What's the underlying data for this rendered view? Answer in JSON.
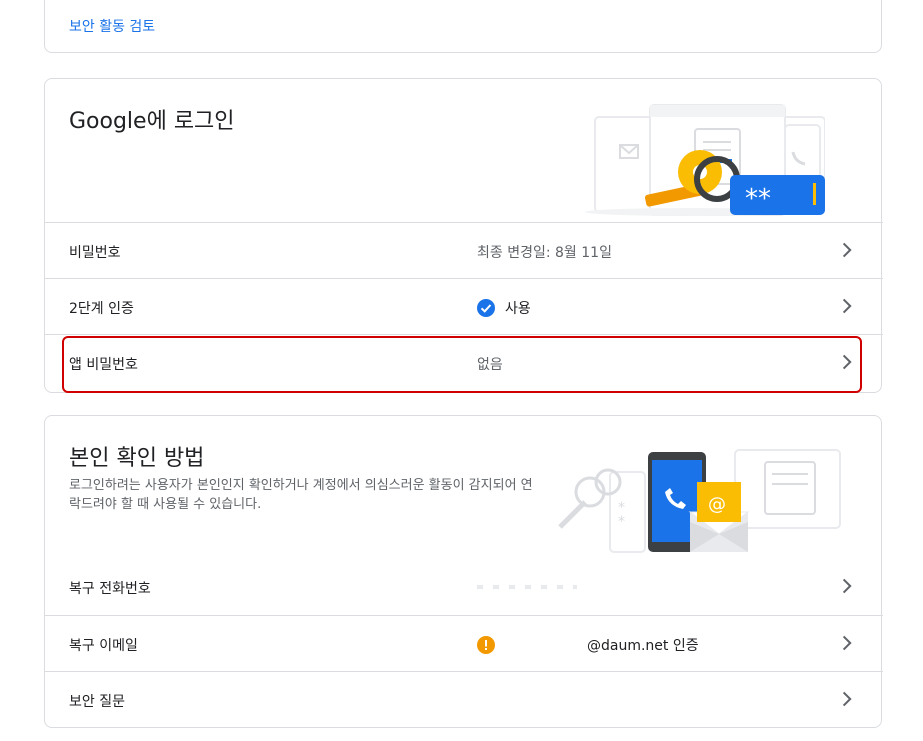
{
  "top_card": {
    "link": "보안 활동 검토"
  },
  "signin": {
    "title": "Google에 로그인",
    "rows": [
      {
        "label": "비밀번호",
        "value": "최종 변경일: 8월 11일"
      },
      {
        "label": "2단계 인증",
        "value": "사용"
      },
      {
        "label": "앱 비밀번호",
        "value": "없음"
      }
    ]
  },
  "verify": {
    "title": "본인 확인 방법",
    "description": "로그인하려는 사용자가 본인인지 확인하거나 계정에서 의심스러운 활동이 감지되어 연락드려야 할 때 사용될 수 있습니다.",
    "rows": [
      {
        "label": "복구 전화번호",
        "value": ""
      },
      {
        "label": "복구 이메일",
        "value": "@daum.net 인증"
      },
      {
        "label": "보안 질문",
        "value": ""
      }
    ]
  },
  "colors": {
    "accent": "#1a73e8",
    "warning": "#f29900",
    "highlight": "#d00000"
  }
}
